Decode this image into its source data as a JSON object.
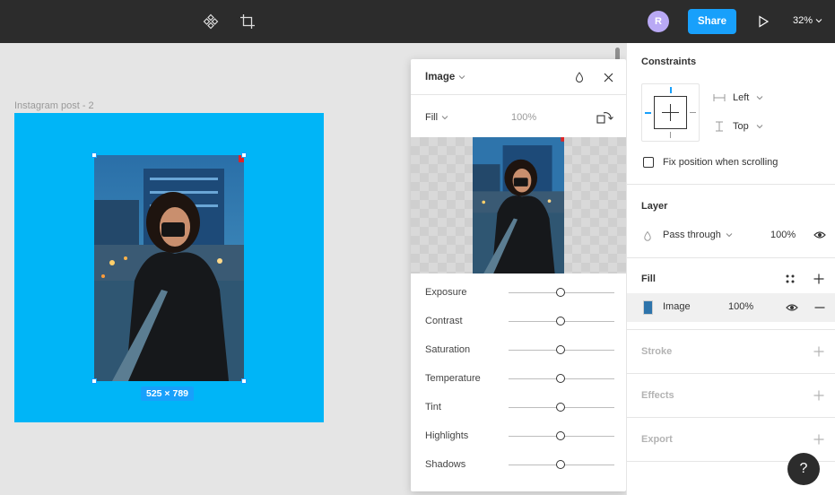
{
  "topbar": {
    "avatar_initial": "R",
    "share_label": "Share",
    "zoom_level": "32%"
  },
  "canvas": {
    "frame_label": "Instagram post - 2",
    "dimension_label": "525 × 789"
  },
  "image_panel": {
    "title": "Image",
    "fill_mode": "Fill",
    "opacity": "100%",
    "adjustments": [
      {
        "label": "Exposure",
        "value": 0
      },
      {
        "label": "Contrast",
        "value": 0
      },
      {
        "label": "Saturation",
        "value": 0
      },
      {
        "label": "Temperature",
        "value": 0
      },
      {
        "label": "Tint",
        "value": 0
      },
      {
        "label": "Highlights",
        "value": 0
      },
      {
        "label": "Shadows",
        "value": 0
      }
    ]
  },
  "sidebar": {
    "constraints": {
      "title": "Constraints",
      "horizontal": "Left",
      "vertical": "Top",
      "fix_position_label": "Fix position when scrolling"
    },
    "layer": {
      "title": "Layer",
      "blend_mode": "Pass through",
      "opacity": "100%"
    },
    "fill": {
      "title": "Fill",
      "item_label": "Image",
      "item_opacity": "100%"
    },
    "stroke_title": "Stroke",
    "effects_title": "Effects",
    "export_title": "Export"
  },
  "help_label": "?",
  "colors": {
    "accent": "#18a0fb",
    "frame_fill": "#00b5f7",
    "topbar": "#2c2c2c",
    "avatar": "#b9a9f5"
  }
}
